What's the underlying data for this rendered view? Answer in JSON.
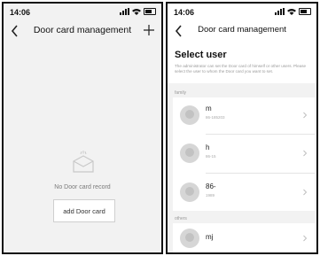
{
  "left": {
    "status": {
      "time": "14:06"
    },
    "nav": {
      "title": "Door card management"
    },
    "empty": {
      "text": "No Door card record",
      "add_label": "add Door card"
    }
  },
  "right": {
    "status": {
      "time": "14:06"
    },
    "nav": {
      "title": "Door card management"
    },
    "heading": "Select user",
    "description": "The administrator can set the Door card of himself or other users. Please select the user to whom the Door card you want to set.",
    "sections": {
      "family": "family",
      "others": "others"
    },
    "users": [
      {
        "name": "m",
        "phone": "86-185203"
      },
      {
        "name": "h",
        "phone": "86-15"
      },
      {
        "name": "86-",
        "phone": "1989"
      },
      {
        "name": "mj",
        "phone": ""
      }
    ]
  },
  "icons": {
    "back": "chevron-left-icon",
    "add": "plus-icon",
    "empty": "empty-mailbox-icon",
    "row_arrow": "chevron-right-icon"
  }
}
